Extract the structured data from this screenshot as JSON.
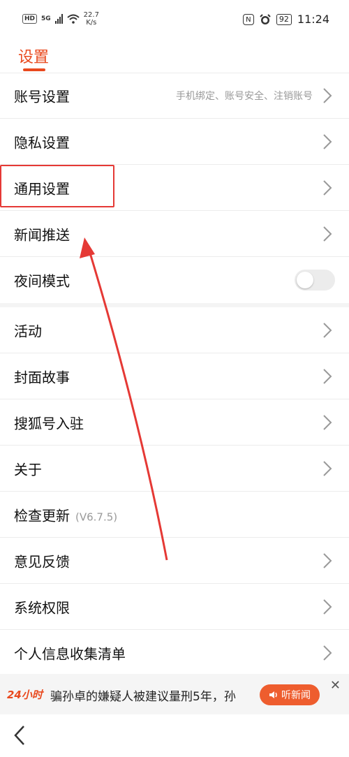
{
  "status_bar": {
    "hd": "HD",
    "network": "5G",
    "speed_value": "22.7",
    "speed_unit": "K/s",
    "nfc": "N",
    "battery": "92",
    "time": "11:24"
  },
  "header": {
    "title": "设置"
  },
  "settings": {
    "account": {
      "label": "账号设置",
      "sub": "手机绑定、账号安全、注销账号"
    },
    "privacy": {
      "label": "隐私设置"
    },
    "general": {
      "label": "通用设置"
    },
    "push": {
      "label": "新闻推送"
    },
    "night": {
      "label": "夜间模式",
      "enabled": false
    },
    "activity": {
      "label": "活动"
    },
    "cover": {
      "label": "封面故事"
    },
    "sohu": {
      "label": "搜狐号入驻"
    },
    "about": {
      "label": "关于"
    },
    "update": {
      "label": "检查更新",
      "version": "(V6.7.5)"
    },
    "feedback": {
      "label": "意见反馈"
    },
    "permissions": {
      "label": "系统权限"
    },
    "info_list": {
      "label": "个人信息收集清单"
    }
  },
  "news_bar": {
    "badge": "24小时",
    "headline": "骗孙卓的嫌疑人被建议量刑5年，孙",
    "listen_label": "听新闻",
    "close": "✕"
  },
  "colors": {
    "accent": "#e9491e",
    "annotation": "#e53935"
  }
}
